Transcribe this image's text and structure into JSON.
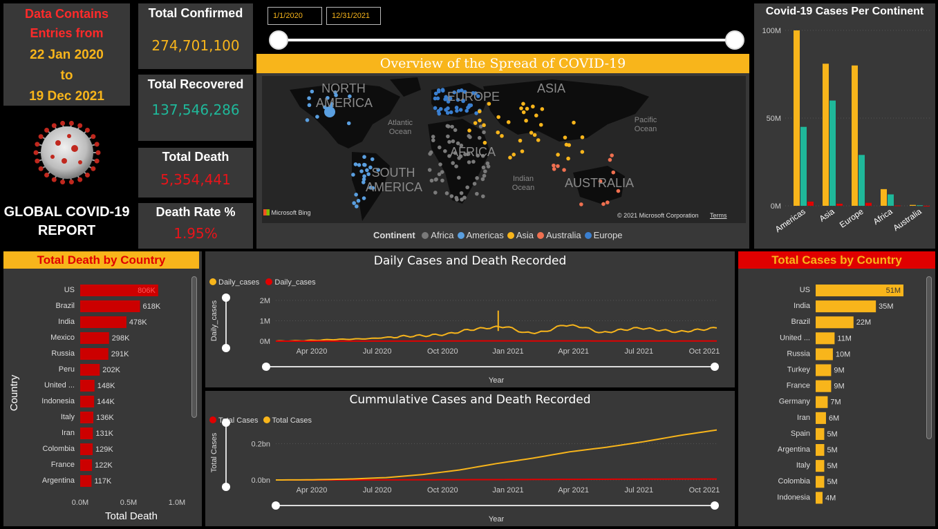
{
  "info": {
    "line1": "Data Contains",
    "line2": "Entries from",
    "start": "22 Jan 2020",
    "to": "to",
    "end": "19 Dec 2021"
  },
  "report_title": {
    "line1": "GLOBAL COVID-19",
    "line2": "REPORT"
  },
  "kpis": {
    "confirmed": {
      "label": "Total Confirmed",
      "value": "274,701,100"
    },
    "recovered": {
      "label": "Total Recovered",
      "value": "137,546,286"
    },
    "death": {
      "label": "Total Death",
      "value": "5,354,441"
    },
    "rate": {
      "label": "Death Rate %",
      "value": "1.95%"
    }
  },
  "date_filter": {
    "start": "1/1/2020",
    "end": "12/31/2021"
  },
  "map": {
    "title": "Overview of the Spread of COVID-19",
    "labels": {
      "north_america": "NORTH AMERICA",
      "europe": "EUROPE",
      "asia": "ASIA",
      "africa": "AFRICA",
      "south_america": "SOUTH AMERICA",
      "australia": "AUSTRALIA",
      "atlantic": "Atlantic Ocean",
      "pacific": "Pacific Ocean",
      "indian": "Indian Ocean"
    },
    "bing": "Microsoft Bing",
    "copyright": "© 2021 Microsoft Corporation",
    "terms": "Terms",
    "legend_title": "Continent",
    "legend": [
      {
        "name": "Africa",
        "color": "#7a7a7a"
      },
      {
        "name": "Americas",
        "color": "#5a9fe0"
      },
      {
        "name": "Asia",
        "color": "#f8b51b"
      },
      {
        "name": "Australia",
        "color": "#f07050"
      },
      {
        "name": "Europe",
        "color": "#3a7fd0"
      }
    ]
  },
  "colors": {
    "yellow": "#f8b51b",
    "red": "#e00000",
    "teal": "#1fb89a",
    "panel": "#383838"
  },
  "continent_chart": {
    "title": "Covid-19 Cases Per Continent",
    "chart_data": {
      "type": "bar",
      "categories": [
        "Americas",
        "Asia",
        "Europe",
        "Africa",
        "Australia"
      ],
      "yticks": [
        "0M",
        "50M",
        "100M"
      ],
      "ylim": [
        0,
        100
      ],
      "series": [
        {
          "values": [
            100,
            81,
            80,
            9.5,
            0.5
          ],
          "color": "#f8b51b"
        },
        {
          "values": [
            45,
            60,
            29,
            6.5,
            0.3
          ],
          "color": "#1fb89a"
        },
        {
          "values": [
            2.4,
            1.2,
            1.7,
            0.2,
            0.01
          ],
          "color": "#e00000"
        }
      ]
    }
  },
  "death_by_country": {
    "title": "Total Death by Country",
    "ylabel": "Country",
    "xlabel": "Total Death",
    "xticks": [
      "0.0M",
      "0.5M",
      "1.0M"
    ],
    "chart_data": {
      "type": "bar",
      "categories": [
        "US",
        "Brazil",
        "India",
        "Mexico",
        "Russia",
        "Peru",
        "United ...",
        "Indonesia",
        "Italy",
        "Iran",
        "Colombia",
        "France",
        "Argentina"
      ],
      "values": [
        806,
        618,
        478,
        298,
        291,
        202,
        148,
        144,
        136,
        131,
        129,
        122,
        117
      ],
      "labels": [
        "806K",
        "618K",
        "478K",
        "298K",
        "291K",
        "202K",
        "148K",
        "144K",
        "136K",
        "131K",
        "129K",
        "122K",
        "117K"
      ],
      "xlim": [
        0,
        1000
      ]
    }
  },
  "cases_by_country": {
    "title": "Total Cases by Country",
    "chart_data": {
      "type": "bar",
      "categories": [
        "US",
        "India",
        "Brazil",
        "United ...",
        "Russia",
        "Turkey",
        "France",
        "Germany",
        "Iran",
        "Spain",
        "Argentina",
        "Italy",
        "Colombia",
        "Indonesia"
      ],
      "values": [
        51,
        35,
        22,
        11,
        10,
        9,
        9,
        7,
        6,
        5,
        5,
        5,
        5,
        4
      ],
      "labels": [
        "51M",
        "35M",
        "22M",
        "11M",
        "10M",
        "9M",
        "9M",
        "7M",
        "6M",
        "5M",
        "5M",
        "5M",
        "5M",
        "4M"
      ],
      "xlim": [
        0,
        51
      ]
    }
  },
  "daily_chart": {
    "title": "Daily Cases and Death Recorded",
    "legend": [
      "Daily_cases",
      "Daily_cases"
    ],
    "ylabel": "Daily_cases",
    "xlabel": "Year",
    "yticks": [
      "0M",
      "1M",
      "2M"
    ],
    "xticks": [
      "Apr 2020",
      "Jul 2020",
      "Oct 2020",
      "Jan 2021",
      "Apr 2021",
      "Jul 2021",
      "Oct 2021"
    ],
    "chart_data": {
      "type": "line",
      "x": [
        "Jan 2020",
        "Feb 2020",
        "Mar 2020",
        "Apr 2020",
        "May 2020",
        "Jun 2020",
        "Jul 2020",
        "Aug 2020",
        "Sep 2020",
        "Oct 2020",
        "Nov 2020",
        "Dec 2020",
        "Jan 2021",
        "Feb 2021",
        "Mar 2021",
        "Apr 2021",
        "May 2021",
        "Jun 2021",
        "Jul 2021",
        "Aug 2021",
        "Sep 2021",
        "Oct 2021",
        "Nov 2021",
        "Dec 2021"
      ],
      "ylim": [
        0,
        2
      ],
      "series": [
        {
          "color": "#f8b51b",
          "values": [
            0.0,
            0.01,
            0.04,
            0.08,
            0.1,
            0.13,
            0.2,
            0.25,
            0.28,
            0.35,
            0.55,
            0.65,
            0.72,
            0.4,
            0.45,
            0.8,
            0.7,
            0.4,
            0.55,
            0.65,
            0.55,
            0.45,
            0.55,
            0.65
          ]
        },
        {
          "color": "#e00000",
          "values": [
            0.0,
            0.0,
            0.002,
            0.006,
            0.005,
            0.005,
            0.006,
            0.006,
            0.006,
            0.007,
            0.011,
            0.012,
            0.014,
            0.01,
            0.009,
            0.013,
            0.012,
            0.009,
            0.008,
            0.01,
            0.01,
            0.008,
            0.008,
            0.008
          ]
        }
      ]
    }
  },
  "cumulative_chart": {
    "title": "Cummulative Cases and Death Recorded",
    "legend": [
      "Total Cases",
      "Total Cases"
    ],
    "ylabel": "Total Cases",
    "xlabel": "Year",
    "yticks": [
      "0.0bn",
      "0.2bn"
    ],
    "xticks": [
      "Apr 2020",
      "Jul 2020",
      "Oct 2020",
      "Jan 2021",
      "Apr 2021",
      "Jul 2021",
      "Oct 2021"
    ],
    "chart_data": {
      "type": "line",
      "x": [
        "Jan 2020",
        "Mar 2020",
        "May 2020",
        "Jul 2020",
        "Sep 2020",
        "Nov 2020",
        "Jan 2021",
        "Mar 2021",
        "May 2021",
        "Jul 2021",
        "Sep 2021",
        "Nov 2021",
        "Dec 2021"
      ],
      "ylim": [
        0,
        0.3
      ],
      "series": [
        {
          "color": "#e00000",
          "values": [
            0,
            0,
            0,
            0.0005,
            0.001,
            0.0015,
            0.002,
            0.0027,
            0.0033,
            0.004,
            0.0046,
            0.0051,
            0.0054
          ]
        },
        {
          "color": "#f8b51b",
          "values": [
            0,
            0.001,
            0.005,
            0.013,
            0.03,
            0.055,
            0.09,
            0.12,
            0.155,
            0.18,
            0.21,
            0.245,
            0.275
          ]
        }
      ]
    }
  }
}
